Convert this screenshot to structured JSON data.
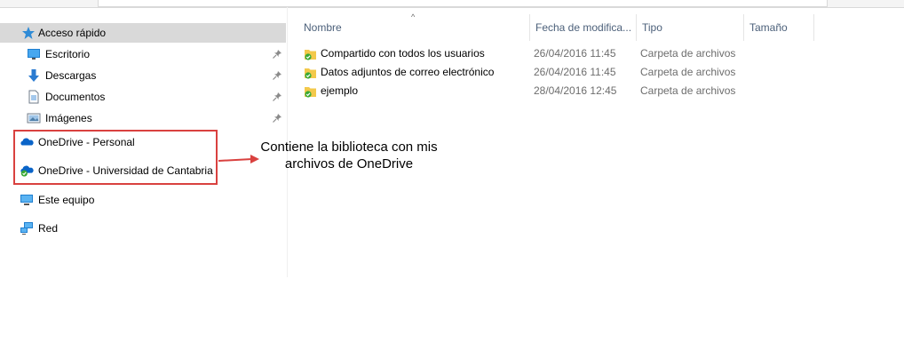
{
  "nav": {
    "quick_access": "Acceso rápido",
    "items": [
      {
        "label": "Escritorio",
        "icon": "desktop-icon",
        "pinned": true
      },
      {
        "label": "Descargas",
        "icon": "downloads-icon",
        "pinned": true
      },
      {
        "label": "Documentos",
        "icon": "documents-icon",
        "pinned": true
      },
      {
        "label": "Imágenes",
        "icon": "pictures-icon",
        "pinned": true
      }
    ],
    "onedrive_personal": "OneDrive - Personal",
    "onedrive_unican": "OneDrive - Universidad de Cantabria",
    "this_pc": "Este equipo",
    "network": "Red"
  },
  "annotation": {
    "line1": "Contiene la biblioteca con mis",
    "line2": "archivos de OneDrive",
    "color": "#d9413f"
  },
  "columns": {
    "name": "Nombre",
    "date": "Fecha de modifica...",
    "type": "Tipo",
    "size": "Tamaño"
  },
  "files": [
    {
      "name": "Compartido con todos los usuarios",
      "date": "26/04/2016 11:45",
      "type": "Carpeta de archivos"
    },
    {
      "name": "Datos adjuntos de correo electrónico",
      "date": "26/04/2016 11:45",
      "type": "Carpeta de archivos"
    },
    {
      "name": "ejemplo",
      "date": "28/04/2016 12:45",
      "type": "Carpeta de archivos"
    }
  ],
  "colors": {
    "selected_bg": "#d9d9d9",
    "onedrive_blue": "#0a64c8",
    "sync_green": "#3aa935",
    "folder_yellow": "#f3c94b"
  }
}
